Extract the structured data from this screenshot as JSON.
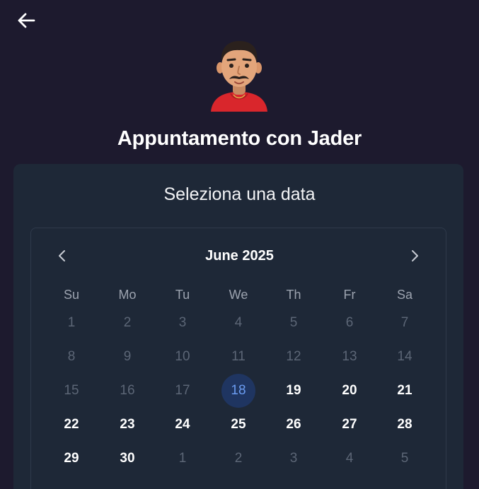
{
  "header": {
    "back_icon": "arrow-left-icon",
    "avatar_icon": "person-avatar-icon",
    "title": "Appuntamento con Jader"
  },
  "card": {
    "title": "Seleziona una data"
  },
  "calendar": {
    "month_label": "June 2025",
    "prev_icon": "chevron-left-icon",
    "next_icon": "chevron-right-icon",
    "weekdays": [
      "Su",
      "Mo",
      "Tu",
      "We",
      "Th",
      "Fr",
      "Sa"
    ],
    "weeks": [
      [
        {
          "d": "1",
          "s": "disabled"
        },
        {
          "d": "2",
          "s": "disabled"
        },
        {
          "d": "3",
          "s": "disabled"
        },
        {
          "d": "4",
          "s": "disabled"
        },
        {
          "d": "5",
          "s": "disabled"
        },
        {
          "d": "6",
          "s": "disabled"
        },
        {
          "d": "7",
          "s": "disabled"
        }
      ],
      [
        {
          "d": "8",
          "s": "disabled"
        },
        {
          "d": "9",
          "s": "disabled"
        },
        {
          "d": "10",
          "s": "disabled"
        },
        {
          "d": "11",
          "s": "disabled"
        },
        {
          "d": "12",
          "s": "disabled"
        },
        {
          "d": "13",
          "s": "disabled"
        },
        {
          "d": "14",
          "s": "disabled"
        }
      ],
      [
        {
          "d": "15",
          "s": "disabled"
        },
        {
          "d": "16",
          "s": "disabled"
        },
        {
          "d": "17",
          "s": "disabled"
        },
        {
          "d": "18",
          "s": "selected"
        },
        {
          "d": "19",
          "s": "available"
        },
        {
          "d": "20",
          "s": "available"
        },
        {
          "d": "21",
          "s": "available"
        }
      ],
      [
        {
          "d": "22",
          "s": "available"
        },
        {
          "d": "23",
          "s": "available"
        },
        {
          "d": "24",
          "s": "available"
        },
        {
          "d": "25",
          "s": "available"
        },
        {
          "d": "26",
          "s": "available"
        },
        {
          "d": "27",
          "s": "available"
        },
        {
          "d": "28",
          "s": "available"
        }
      ],
      [
        {
          "d": "29",
          "s": "available"
        },
        {
          "d": "30",
          "s": "available"
        },
        {
          "d": "1",
          "s": "outside"
        },
        {
          "d": "2",
          "s": "outside"
        },
        {
          "d": "3",
          "s": "outside"
        },
        {
          "d": "4",
          "s": "outside"
        },
        {
          "d": "5",
          "s": "outside"
        }
      ]
    ]
  },
  "colors": {
    "background": "#1d1a2e",
    "card": "#1e2837",
    "selected_bg": "#1f3561",
    "selected_text": "#6b9cf0",
    "disabled_text": "#5c6676"
  }
}
